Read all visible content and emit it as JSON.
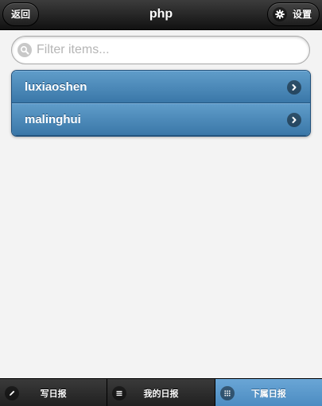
{
  "header": {
    "title": "php",
    "back_label": "返回",
    "settings_label": "设置",
    "settings_icon": "gear-icon"
  },
  "search": {
    "placeholder": "Filter items...",
    "value": "",
    "icon": "search-icon"
  },
  "list": {
    "items": [
      {
        "label": "luxiaoshen",
        "icon": "chevron-right-icon"
      },
      {
        "label": "malinghui",
        "icon": "chevron-right-icon"
      }
    ]
  },
  "footer": {
    "tabs": [
      {
        "label": "写日报",
        "icon": "pencil-icon",
        "active": false
      },
      {
        "label": "我的日报",
        "icon": "list-icon",
        "active": false
      },
      {
        "label": "下属日报",
        "icon": "grid-icon",
        "active": true
      }
    ]
  },
  "colors": {
    "header_bg": "#1e1e1e",
    "list_item_bg": "#4a86b8",
    "active_tab_bg": "#5a99cc",
    "page_bg": "#f3f3f3"
  }
}
